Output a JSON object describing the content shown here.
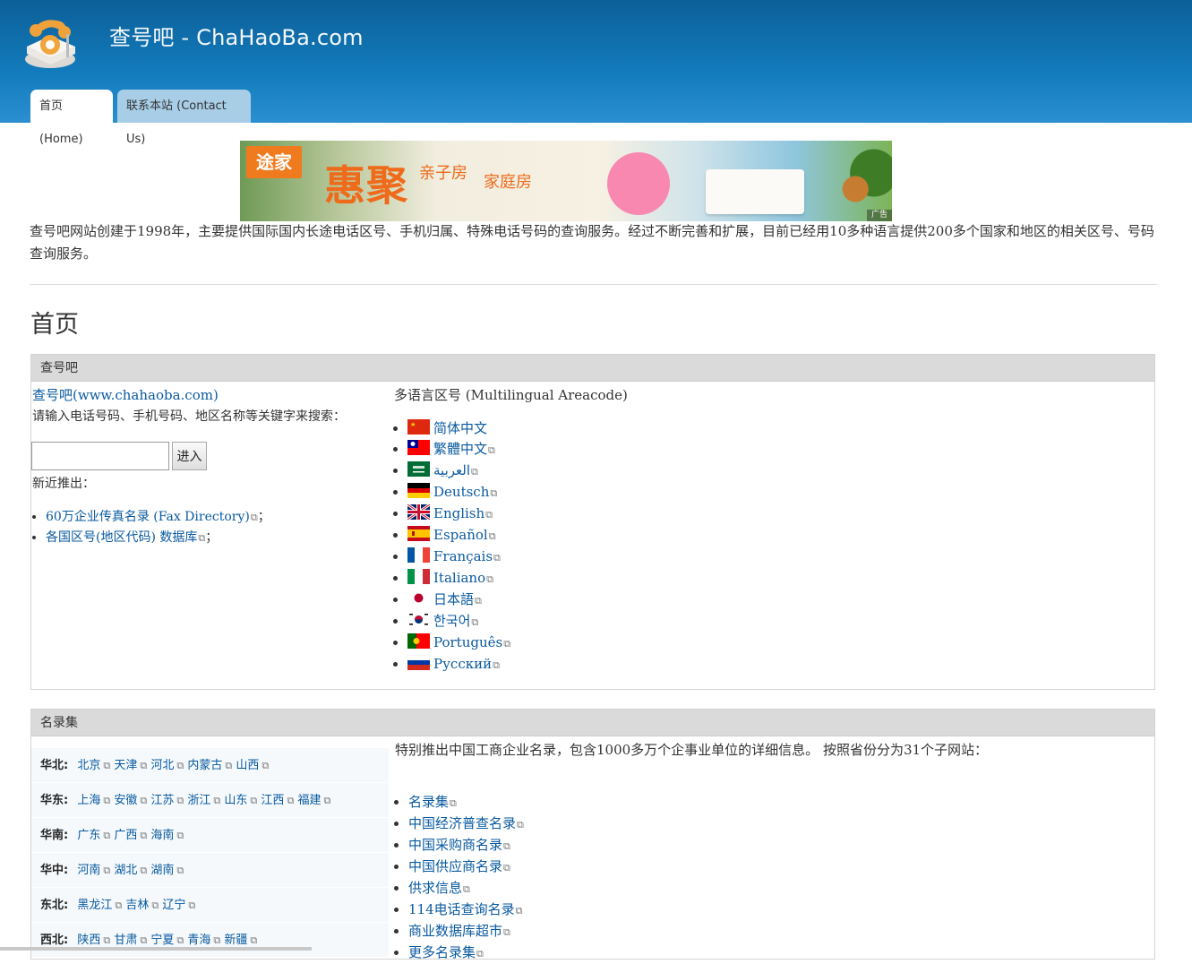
{
  "header": {
    "site_name": "查号吧 - ChaHaoBa.com",
    "tabs": [
      {
        "label": "首页 (Home)"
      },
      {
        "label": "联系本站 (Contact Us)"
      }
    ]
  },
  "ad": {
    "brand": "途家",
    "headline": "惠聚",
    "sub1": "亲子房",
    "sub2": "家庭房",
    "tag": "广告"
  },
  "intro": "查号吧网站创建于1998年，主要提供国际国内长途电话区号、手机归属、特殊电话号码的查询服务。经过不断完善和扩展，目前已经用10多种语言提供200多个国家和地区的相关区号、号码查询服务。",
  "page_title": "首页",
  "panel1": {
    "title": "查号吧",
    "home_link": "查号吧(www.chahaoba.com)",
    "prompt": "请输入电话号码、手机号码、地区名称等关键字来搜索：",
    "search_value": "",
    "search_button": "进入",
    "recent_label": "新近推出：",
    "recent": [
      {
        "text": "60万企业传真名录 (Fax Directory)",
        "suffix": "；"
      },
      {
        "text": "各国区号(地区代码) 数据库",
        "suffix": "；"
      }
    ],
    "lang_title": "多语言区号 (Multilingual Areacode)",
    "languages": [
      {
        "label": "简体中文",
        "flag": "cn",
        "external": false
      },
      {
        "label": "繁體中文",
        "flag": "tw",
        "external": true
      },
      {
        "label": "العربية",
        "flag": "sa",
        "external": true
      },
      {
        "label": "Deutsch",
        "flag": "de",
        "external": true
      },
      {
        "label": "English",
        "flag": "gb",
        "external": true
      },
      {
        "label": "Español",
        "flag": "es",
        "external": true
      },
      {
        "label": "Français",
        "flag": "fr",
        "external": true
      },
      {
        "label": "Italiano",
        "flag": "it",
        "external": true
      },
      {
        "label": "日本語",
        "flag": "jp",
        "external": true
      },
      {
        "label": "한국어",
        "flag": "kr",
        "external": true
      },
      {
        "label": "Português",
        "flag": "pt",
        "external": true
      },
      {
        "label": "Русский",
        "flag": "ru",
        "external": true
      }
    ]
  },
  "panel2": {
    "title": "名录集",
    "regions": [
      {
        "name": "华北:",
        "places": [
          "北京",
          "天津",
          "河北",
          "内蒙古",
          "山西"
        ]
      },
      {
        "name": "华东:",
        "places": [
          "上海",
          "安徽",
          "江苏",
          "浙江",
          "山东",
          "江西",
          "福建"
        ]
      },
      {
        "name": "华南:",
        "places": [
          "广东",
          "广西",
          "海南"
        ]
      },
      {
        "name": "华中:",
        "places": [
          "河南",
          "湖北",
          "湖南"
        ]
      },
      {
        "name": "东北:",
        "places": [
          "黑龙江",
          "吉林",
          "辽宁"
        ]
      },
      {
        "name": "西北:",
        "places": [
          "陕西",
          "甘肃",
          "宁夏",
          "青海",
          "新疆"
        ]
      }
    ],
    "desc": "特别推出中国工商企业名录，包含1000多万个企事业单位的详细信息。 按照省份分为31个子网站：",
    "directories": [
      "名录集",
      "中国经济普查名录",
      "中国采购商名录",
      "中国供应商名录",
      "供求信息",
      "114电话查询名录",
      "商业数据库超市",
      "更多名录集"
    ]
  }
}
